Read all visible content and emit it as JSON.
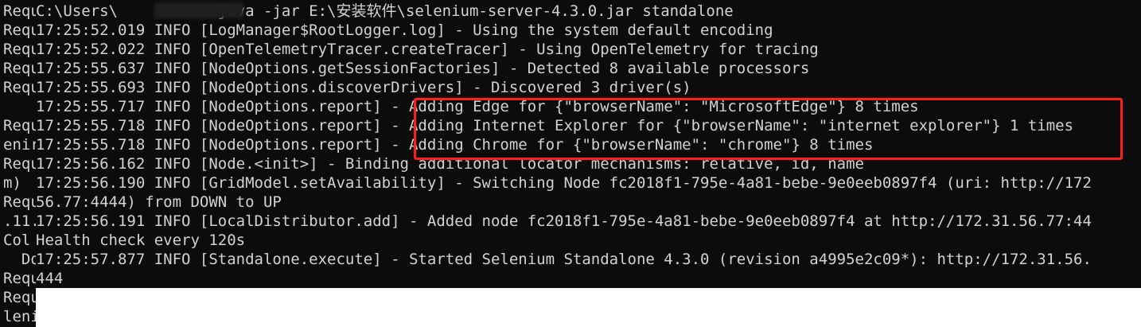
{
  "left_strip": [
    "Requ",
    "Requ",
    "Requ",
    "Requ",
    "Requ",
    "",
    "Requ",
    "enir",
    "Requ",
    "m)",
    "Requ",
    ".11.",
    "Col",
    "  Do",
    "Requ",
    "Requ",
    "leni"
  ],
  "terminal": {
    "prompt_line": "C:\\Users\\          >java -jar E:\\安装软件\\selenium-server-4.3.0.jar standalone",
    "lines": [
      "17:25:52.019 INFO [LogManager$RootLogger.log] - Using the system default encoding",
      "17:25:52.022 INFO [OpenTelemetryTracer.createTracer] - Using OpenTelemetry for tracing",
      "17:25:55.637 INFO [NodeOptions.getSessionFactories] - Detected 8 available processors",
      "17:25:55.693 INFO [NodeOptions.discoverDrivers] - Discovered 3 driver(s)",
      "17:25:55.717 INFO [NodeOptions.report] - Adding Edge for {\"browserName\": \"MicrosoftEdge\"} 8 times",
      "17:25:55.718 INFO [NodeOptions.report] - Adding Internet Explorer for {\"browserName\": \"internet explorer\"} 1 times",
      "17:25:55.718 INFO [NodeOptions.report] - Adding Chrome for {\"browserName\": \"chrome\"} 8 times",
      "17:25:56.162 INFO [Node.<init>] - Binding additional locator mechanisms: relative, id, name",
      "17:25:56.190 INFO [GridModel.setAvailability] - Switching Node fc2018f1-795e-4a81-bebe-9e0eeb0897f4 (uri: http://172",
      "56.77:4444) from DOWN to UP",
      "17:25:56.191 INFO [LocalDistributor.add] - Added node fc2018f1-795e-4a81-bebe-9e0eeb0897f4 at http://172.31.56.77:44",
      "Health check every 120s",
      "17:25:57.877 INFO [Standalone.execute] - Started Selenium Standalone 4.3.0 (revision a4995e2c09*): http://172.31.56.",
      "444"
    ]
  },
  "colors": {
    "background": "#0c0c0c",
    "text": "#d2d2d2",
    "highlight": "#ff1e1e",
    "bottom_fill": "#ffffff"
  }
}
